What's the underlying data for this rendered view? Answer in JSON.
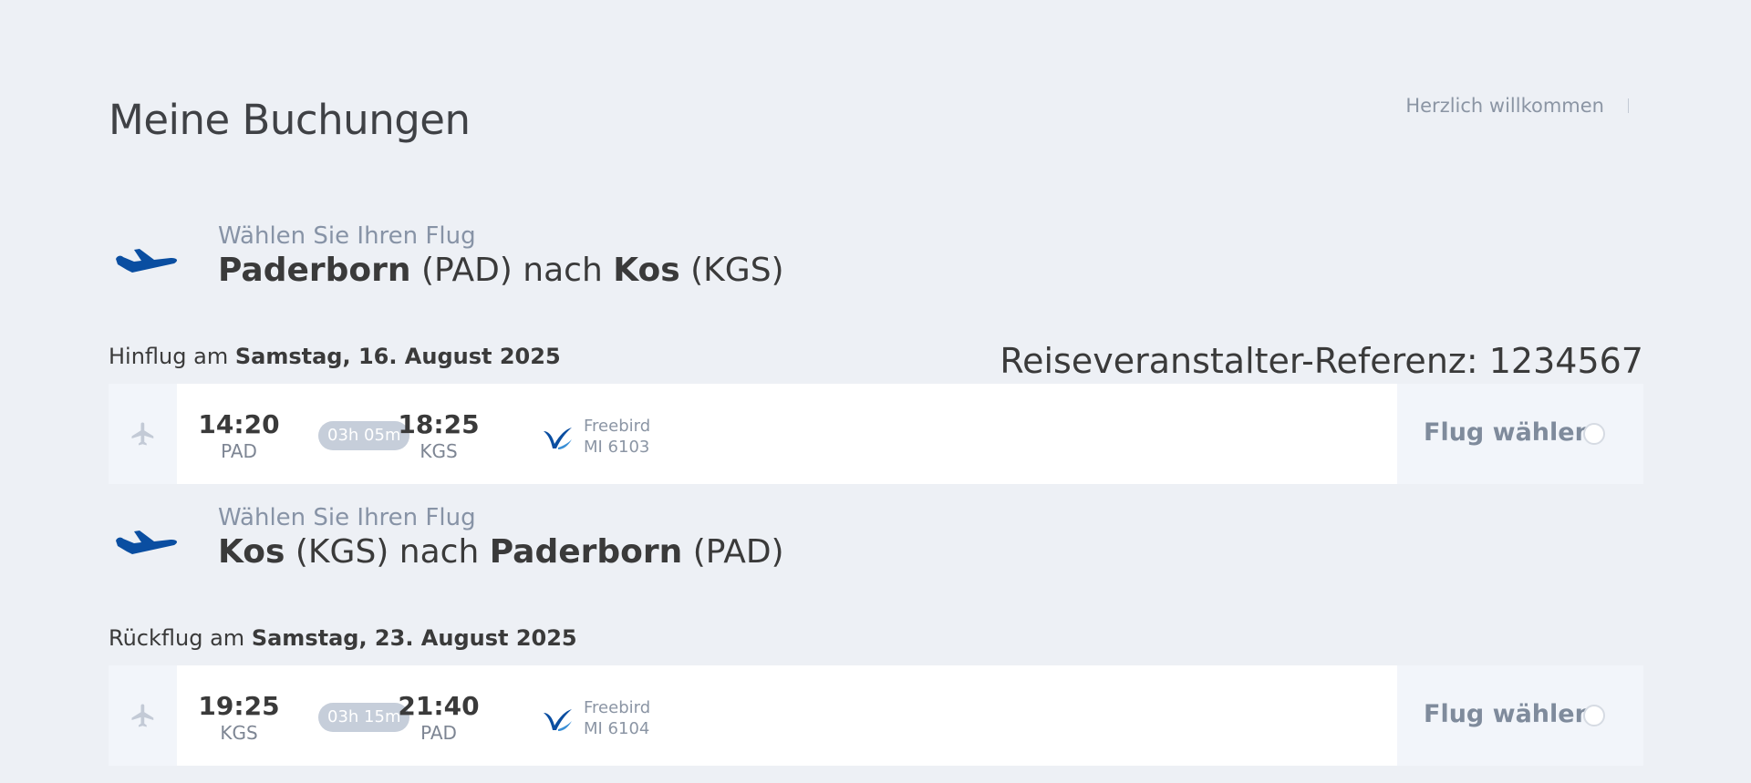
{
  "header": {
    "title": "Meine Buchungen",
    "welcome": "Herzlich willkommen"
  },
  "reference": {
    "label": "Reiseveranstalter-Referenz:",
    "value": "1234567"
  },
  "legs": [
    {
      "prompt": "Wählen Sie Ihren Flug",
      "origin_city": "Paderborn",
      "origin_code": "(PAD)",
      "connector": "nach",
      "dest_city": "Kos",
      "dest_code": "(KGS)",
      "date_prefix": "Hinflug am",
      "date": "Samstag, 16. August 2025",
      "flight": {
        "dep_time": "14:20",
        "dep_code": "PAD",
        "duration": "03h 05m",
        "arr_time": "18:25",
        "arr_code": "KGS",
        "airline": "Freebird",
        "flight_no": "MI 6103",
        "select_label": "Flug wählen"
      }
    },
    {
      "prompt": "Wählen Sie Ihren Flug",
      "origin_city": "Kos",
      "origin_code": "(KGS)",
      "connector": "nach",
      "dest_city": "Paderborn",
      "dest_code": "(PAD)",
      "date_prefix": "Rückflug am",
      "date": "Samstag, 23. August 2025",
      "flight": {
        "dep_time": "19:25",
        "dep_code": "KGS",
        "duration": "03h 15m",
        "arr_time": "21:40",
        "arr_code": "PAD",
        "airline": "Freebird",
        "flight_no": "MI 6104",
        "select_label": "Flug wählen"
      }
    }
  ],
  "icons": {
    "leg_plane": "airplane-icon",
    "card_plane": "airplane-small-icon",
    "airline_logo": "freebird-logo"
  },
  "colors": {
    "accent_blue": "#0a4ea1",
    "background": "#edf0f5",
    "muted": "#8793a6",
    "duration_pill": "#c6ceda"
  }
}
